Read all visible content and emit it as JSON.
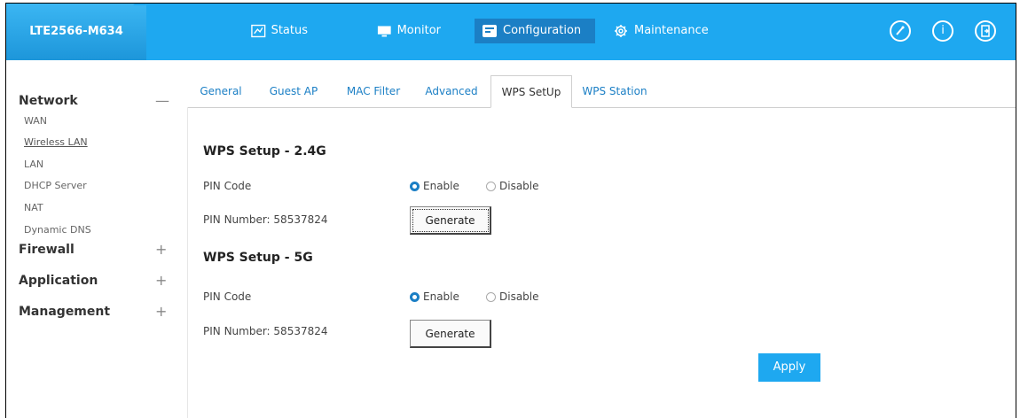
{
  "header": {
    "model": "LTE2566-M634",
    "nav": [
      {
        "label": "Status",
        "icon": "status-icon"
      },
      {
        "label": "Monitor",
        "icon": "monitor-icon"
      },
      {
        "label": "Configuration",
        "icon": "configuration-icon",
        "active": true
      },
      {
        "label": "Maintenance",
        "icon": "gear-icon"
      }
    ],
    "icons": [
      "wizard-icon",
      "info-icon",
      "logout-icon"
    ],
    "info_glyph": "i",
    "accent": "#1ea8f0"
  },
  "sidebar": {
    "network": {
      "label": "Network",
      "sign": "—"
    },
    "network_items": [
      "WAN",
      "Wireless LAN",
      "LAN",
      "DHCP Server",
      "NAT",
      "Dynamic DNS"
    ],
    "firewall": {
      "label": "Firewall",
      "sign": "+"
    },
    "application": {
      "label": "Application",
      "sign": "+"
    },
    "management": {
      "label": "Management",
      "sign": "+"
    }
  },
  "tabs": [
    "General",
    "Guest AP",
    "MAC Filter",
    "Advanced",
    "WPS SetUp",
    "WPS Station"
  ],
  "active_tab": "WPS SetUp",
  "wps24": {
    "title": "WPS Setup - 2.4G",
    "pin_code_label": "PIN Code",
    "enable": "Enable",
    "disable": "Disable",
    "pin_number": "PIN Number: 58537824",
    "generate": "Generate"
  },
  "wps5": {
    "title": "WPS Setup - 5G",
    "pin_code_label": "PIN Code",
    "enable": "Enable",
    "disable": "Disable",
    "pin_number": "PIN Number: 58537824",
    "generate": "Generate"
  },
  "apply": "Apply"
}
